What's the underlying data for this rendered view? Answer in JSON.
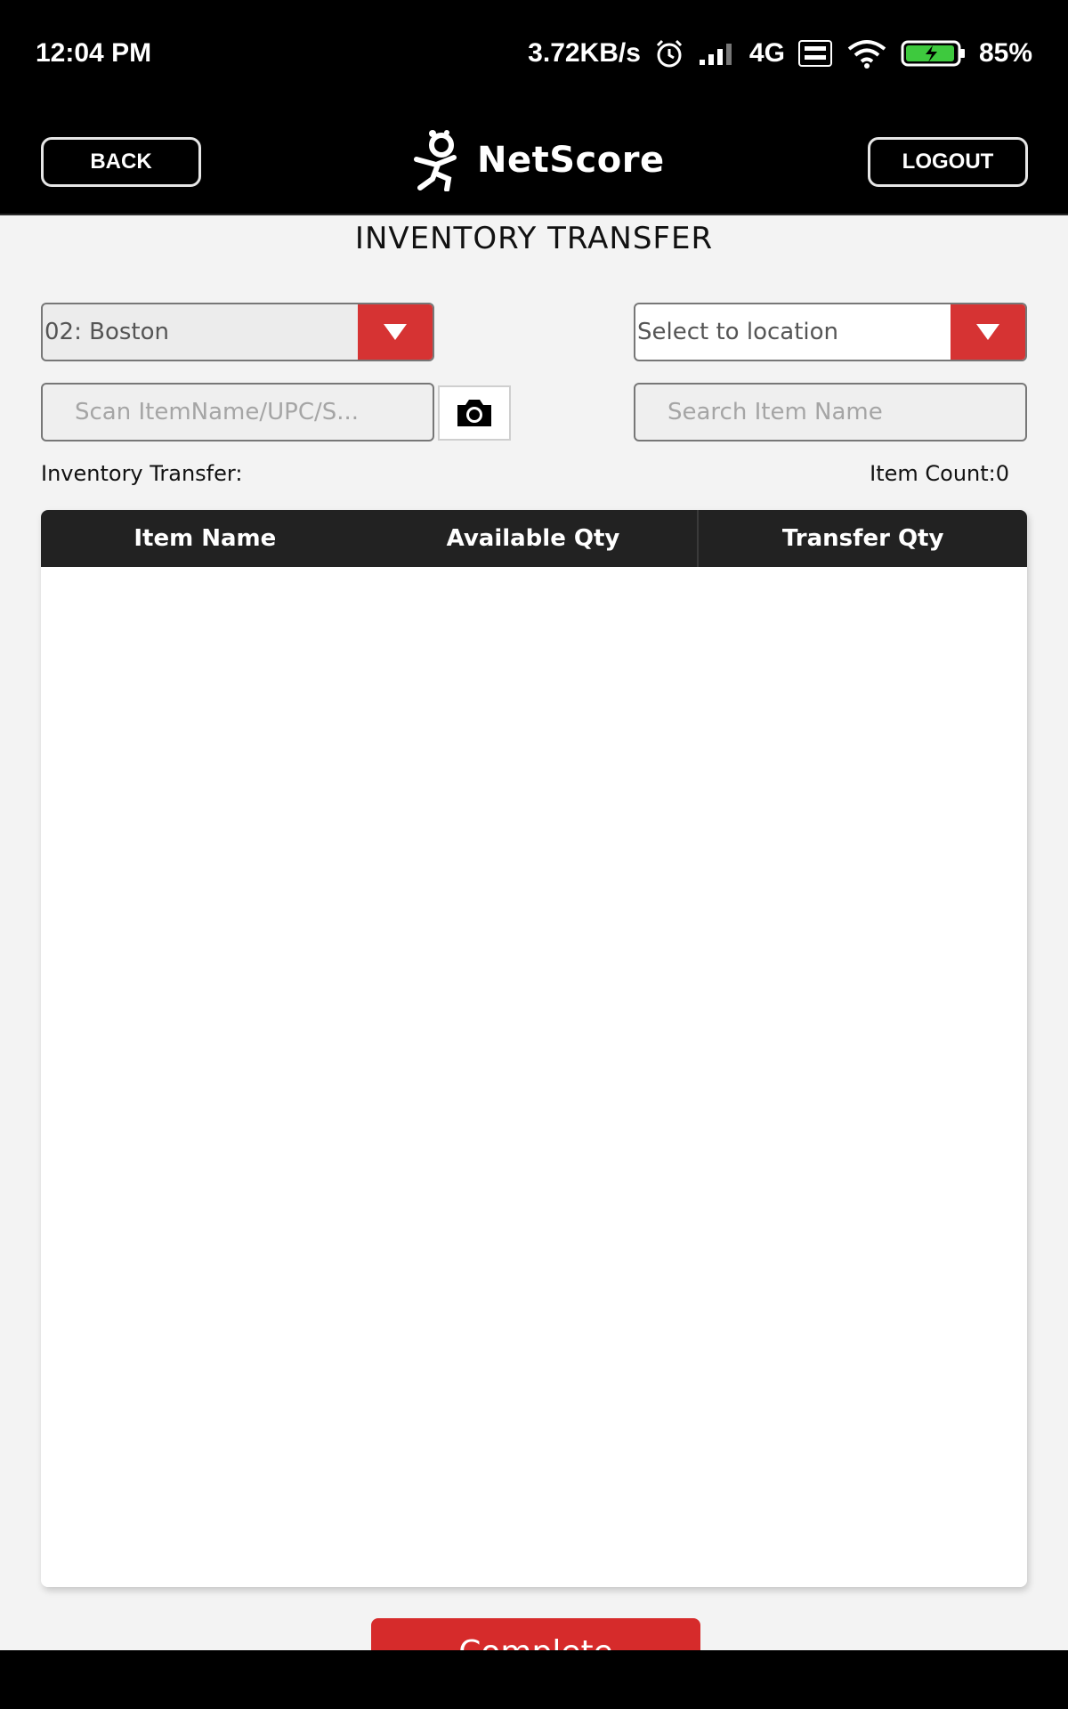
{
  "status_bar": {
    "time": "12:04 PM",
    "network_speed": "3.72KB/s",
    "network_type": "4G",
    "battery": "85%",
    "icons": [
      "alarm-icon",
      "signal-icon",
      "volte-icon",
      "wifi-icon",
      "battery-icon"
    ]
  },
  "header": {
    "back_label": "BACK",
    "logout_label": "LOGOUT",
    "brand_name": "NetScore"
  },
  "page": {
    "title": "INVENTORY TRANSFER"
  },
  "from_location": {
    "value": "02: Boston"
  },
  "to_location": {
    "value": "Select to location"
  },
  "scan": {
    "placeholder": "Scan ItemName/UPC/S..."
  },
  "search": {
    "placeholder": "Search Item Name"
  },
  "info": {
    "label": "Inventory Transfer:",
    "item_count": "Item Count:0"
  },
  "table": {
    "columns": [
      "Item Name",
      "Available Qty",
      "Transfer Qty"
    ],
    "rows": []
  },
  "actions": {
    "complete_label": "Complete"
  },
  "colors": {
    "accent": "#d63333",
    "header_bg": "#000000",
    "table_header_bg": "#222222"
  }
}
